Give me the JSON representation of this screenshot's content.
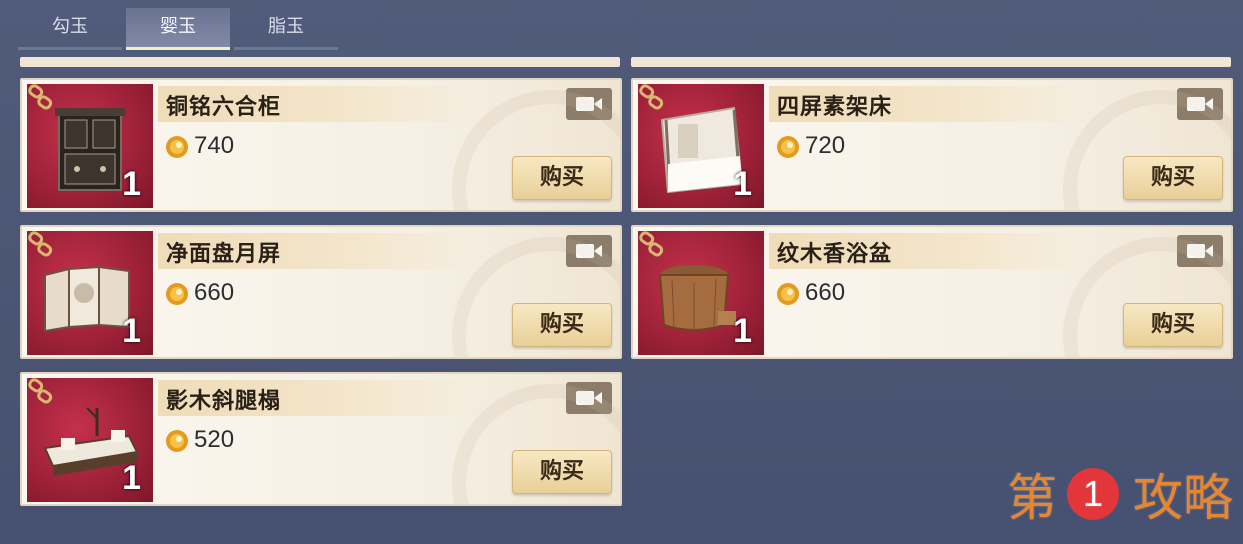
{
  "tabs": [
    {
      "label": "勾玉",
      "active": false
    },
    {
      "label": "婴玉",
      "active": true
    },
    {
      "label": "脂玉",
      "active": false
    }
  ],
  "items": [
    {
      "name": "铜铭六合柜",
      "price": "740",
      "qty": "1",
      "buy_label": "购买",
      "thumb": "cabinet"
    },
    {
      "name": "四屏素架床",
      "price": "720",
      "qty": "1",
      "buy_label": "购买",
      "thumb": "bed"
    },
    {
      "name": "净面盘月屏",
      "price": "660",
      "qty": "1",
      "buy_label": "购买",
      "thumb": "screen"
    },
    {
      "name": "纹木香浴盆",
      "price": "660",
      "qty": "1",
      "buy_label": "购买",
      "thumb": "bathtub"
    },
    {
      "name": "影木斜腿榻",
      "price": "520",
      "qty": "1",
      "buy_label": "购买",
      "thumb": "couch"
    }
  ],
  "watermark": {
    "left": "第",
    "circle": "1",
    "right": "攻略"
  },
  "colors": {
    "accent_orange": "#e8862f",
    "thumb_red": "#a0223a",
    "buy_gold": "#e8cf99"
  }
}
